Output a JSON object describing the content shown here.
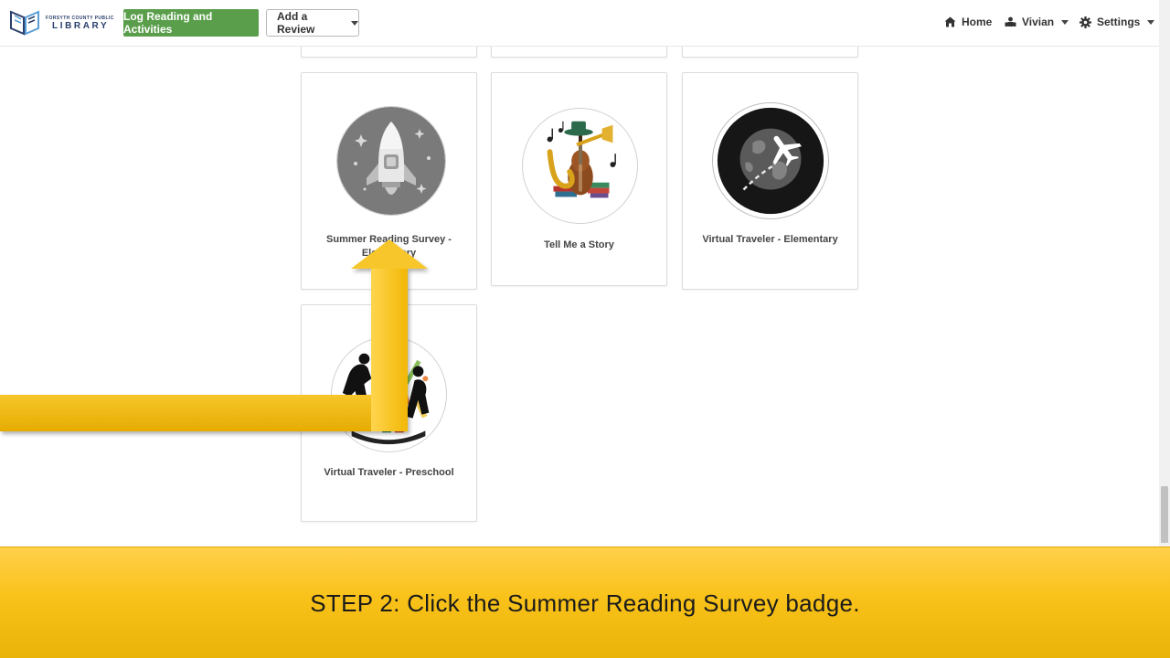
{
  "header": {
    "logo": {
      "small_text": "FORSYTH COUNTY PUBLIC",
      "big_text": "LIBRARY"
    },
    "log_button_label": "Log Reading and Activities",
    "review_button_label": "Add a Review",
    "nav": {
      "home_label": "Home",
      "user_label": "Vivian",
      "settings_label": "Settings"
    }
  },
  "badges": [
    {
      "title": "Summer Reading Survey - Elementary",
      "icon": "rocket-badge"
    },
    {
      "title": "Tell Me a Story",
      "icon": "music-instruments-badge"
    },
    {
      "title": "Virtual Traveler - Elementary",
      "icon": "globe-airplane-badge"
    },
    {
      "title": "Virtual Traveler - Preschool",
      "icon": "dancers-badge"
    }
  ],
  "instruction": {
    "text": "STEP 2: Click the Summer Reading Survey badge."
  },
  "colors": {
    "primary_button": "#5a9e4b",
    "banner": "#f9c21a",
    "arrow": "#f2b705"
  }
}
